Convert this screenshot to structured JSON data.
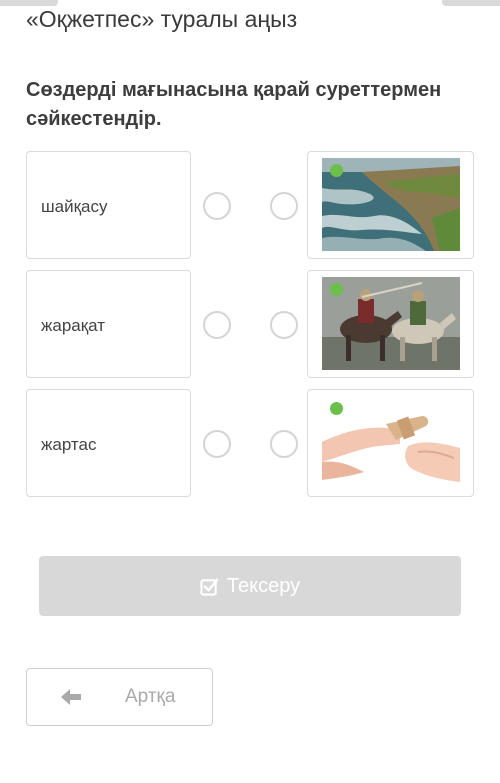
{
  "lesson": {
    "title": "«Оқжетпес» туралы аңыз"
  },
  "task": {
    "question": "Сөздерді мағынасына қарай суреттермен сәйкестендір."
  },
  "words": [
    {
      "label": "шайқасу"
    },
    {
      "label": "жарақат"
    },
    {
      "label": "жартас"
    }
  ],
  "images": [
    {
      "icon": "sea-cliff-image"
    },
    {
      "icon": "horsemen-battle-image"
    },
    {
      "icon": "bandaged-finger-image"
    }
  ],
  "actions": {
    "check_label": "Тексеру",
    "back_label": "Артқа"
  },
  "colors": {
    "button_disabled": "#d8d8d8",
    "badge": "#6cbf4a",
    "border": "#dcdcdc"
  }
}
